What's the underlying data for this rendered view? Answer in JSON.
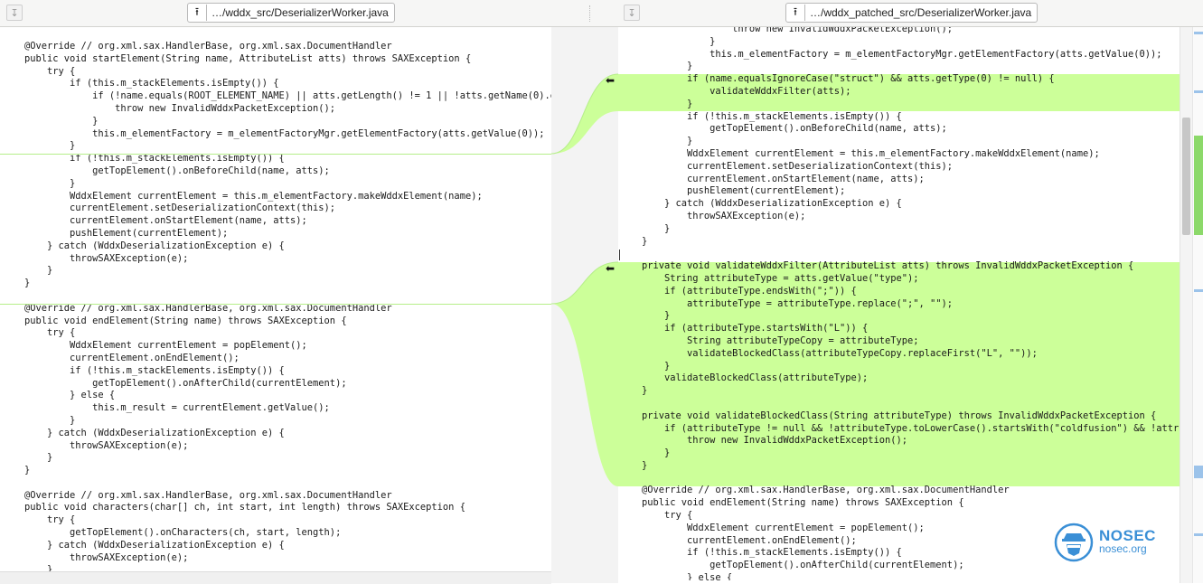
{
  "left_pane": {
    "path": "…/wddx_src/DeserializerWorker.java",
    "lines": [
      "@Override // org.xml.sax.HandlerBase, org.xml.sax.DocumentHandler",
      "public void startElement(String name, AttributeList atts) throws SAXException {",
      "    try {",
      "        if (this.m_stackElements.isEmpty()) {",
      "            if (!name.equals(ROOT_ELEMENT_NAME) || atts.getLength() != 1 || !atts.getName(0).e",
      "                throw new InvalidWddxPacketException();",
      "            }",
      "            this.m_elementFactory = m_elementFactoryMgr.getElementFactory(atts.getValue(0));",
      "        }",
      "        if (!this.m_stackElements.isEmpty()) {",
      "            getTopElement().onBeforeChild(name, atts);",
      "        }",
      "        WddxElement currentElement = this.m_elementFactory.makeWddxElement(name);",
      "        currentElement.setDeserializationContext(this);",
      "        currentElement.onStartElement(name, atts);",
      "        pushElement(currentElement);",
      "    } catch (WddxDeserializationException e) {",
      "        throwSAXException(e);",
      "    }",
      "}",
      "",
      "@Override // org.xml.sax.HandlerBase, org.xml.sax.DocumentHandler",
      "public void endElement(String name) throws SAXException {",
      "    try {",
      "        WddxElement currentElement = popElement();",
      "        currentElement.onEndElement();",
      "        if (!this.m_stackElements.isEmpty()) {",
      "            getTopElement().onAfterChild(currentElement);",
      "        } else {",
      "            this.m_result = currentElement.getValue();",
      "        }",
      "    } catch (WddxDeserializationException e) {",
      "        throwSAXException(e);",
      "    }",
      "}",
      "",
      "@Override // org.xml.sax.HandlerBase, org.xml.sax.DocumentHandler",
      "public void characters(char[] ch, int start, int length) throws SAXException {",
      "    try {",
      "        getTopElement().onCharacters(ch, start, length);",
      "    } catch (WddxDeserializationException e) {",
      "        throwSAXException(e);",
      "    }"
    ]
  },
  "right_pane": {
    "path": "…/wddx_patched_src/DeserializerWorker.java",
    "lines": [
      "                throw new InvalidWddxPacketException();",
      "            }",
      "            this.m_elementFactory = m_elementFactoryMgr.getElementFactory(atts.getValue(0));",
      "        }",
      "        if (name.equalsIgnoreCase(\"struct\") && atts.getType(0) != null) {",
      "            validateWddxFilter(atts);",
      "        }",
      "        if (!this.m_stackElements.isEmpty()) {",
      "            getTopElement().onBeforeChild(name, atts);",
      "        }",
      "        WddxElement currentElement = this.m_elementFactory.makeWddxElement(name);",
      "        currentElement.setDeserializationContext(this);",
      "        currentElement.onStartElement(name, atts);",
      "        pushElement(currentElement);",
      "    } catch (WddxDeserializationException e) {",
      "        throwSAXException(e);",
      "    }",
      "}",
      "",
      "private void validateWddxFilter(AttributeList atts) throws InvalidWddxPacketException {",
      "    String attributeType = atts.getValue(\"type\");",
      "    if (attributeType.endsWith(\";\")) {",
      "        attributeType = attributeType.replace(\";\", \"\");",
      "    }",
      "    if (attributeType.startsWith(\"L\")) {",
      "        String attributeTypeCopy = attributeType;",
      "        validateBlockedClass(attributeTypeCopy.replaceFirst(\"L\", \"\"));",
      "    }",
      "    validateBlockedClass(attributeType);",
      "}",
      "",
      "private void validateBlockedClass(String attributeType) throws InvalidWddxPacketException {",
      "    if (attributeType != null && !attributeType.toLowerCase().startsWith(\"coldfusion\") && !attr",
      "        throw new InvalidWddxPacketException();",
      "    }",
      "}",
      "",
      "@Override // org.xml.sax.HandlerBase, org.xml.sax.DocumentHandler",
      "public void endElement(String name) throws SAXException {",
      "    try {",
      "        WddxElement currentElement = popElement();",
      "        currentElement.onEndElement();",
      "        if (!this.m_stackElements.isEmpty()) {",
      "            getTopElement().onAfterChild(currentElement);",
      "        } else {"
    ]
  },
  "icons": {
    "download": "↧",
    "upload": "⭱",
    "insert_arrow": "⬅"
  },
  "colors": {
    "insert_highlight": "#ccff99",
    "gutter_line": "#b6ee8a",
    "logo_blue": "#3a8fd6"
  },
  "watermark": {
    "name": "NOSEC",
    "domain": "nosec.org"
  }
}
